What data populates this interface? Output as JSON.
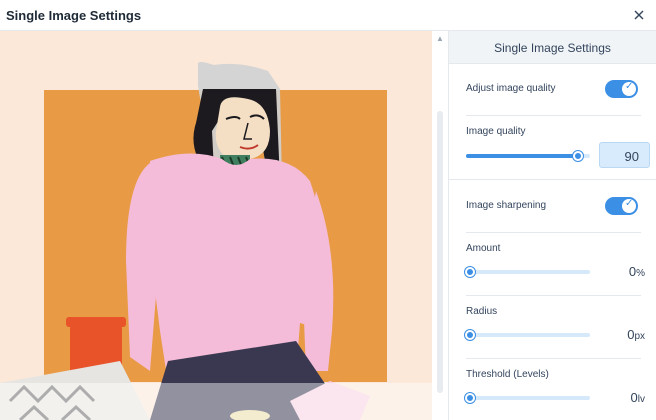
{
  "window": {
    "title": "Single Image Settings",
    "close_icon": "close-icon"
  },
  "panel": {
    "header": "Single Image Settings",
    "adjust_quality": {
      "label": "Adjust image quality",
      "enabled": true
    },
    "image_quality": {
      "label": "Image quality",
      "value": "90",
      "level": 0.9
    },
    "sharpening": {
      "label": "Image sharpening",
      "enabled": true
    },
    "amount": {
      "label": "Amount",
      "value": "0",
      "unit": "%",
      "level": 0
    },
    "radius": {
      "label": "Radius",
      "value": "0",
      "unit": "px",
      "level": 0
    },
    "threshold": {
      "label": "Threshold (Levels)",
      "value": "0",
      "unit": "lv",
      "level": 0
    }
  },
  "colors": {
    "accent": "#3b8fe4",
    "track": "#d6e9fb",
    "preview_bg": "#fbe8d9",
    "orange_panel": "#e89a45"
  }
}
